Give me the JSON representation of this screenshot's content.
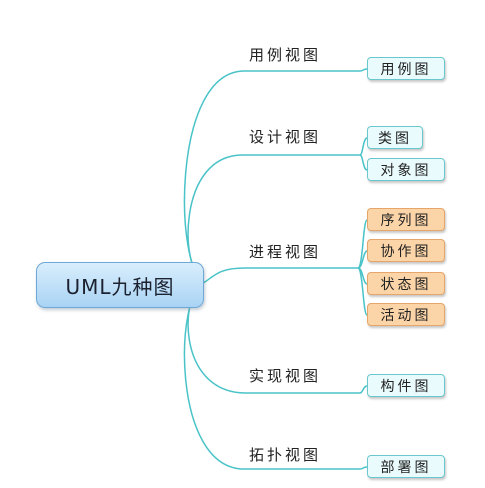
{
  "root": {
    "label": "UML九种图"
  },
  "branches": [
    {
      "label": "用例视图",
      "leaves": [
        {
          "label": "用例图",
          "style": "blue"
        }
      ]
    },
    {
      "label": "设计视图",
      "leaves": [
        {
          "label": "类图",
          "style": "blue"
        },
        {
          "label": "对象图",
          "style": "blue"
        }
      ]
    },
    {
      "label": "进程视图",
      "leaves": [
        {
          "label": "序列图",
          "style": "orange"
        },
        {
          "label": "协作图",
          "style": "orange"
        },
        {
          "label": "状态图",
          "style": "orange"
        },
        {
          "label": "活动图",
          "style": "orange"
        }
      ]
    },
    {
      "label": "实现视图",
      "leaves": [
        {
          "label": "构件图",
          "style": "blue"
        }
      ]
    },
    {
      "label": "拓扑视图",
      "leaves": [
        {
          "label": "部署图",
          "style": "blue"
        }
      ]
    }
  ],
  "colors": {
    "connector": "#49c3c8",
    "root_fill_top": "#d9eefc",
    "root_fill_bottom": "#a9d3f4",
    "leaf_blue_fill": "#e9fbfd",
    "leaf_orange_fill": "#fbd4a8"
  }
}
